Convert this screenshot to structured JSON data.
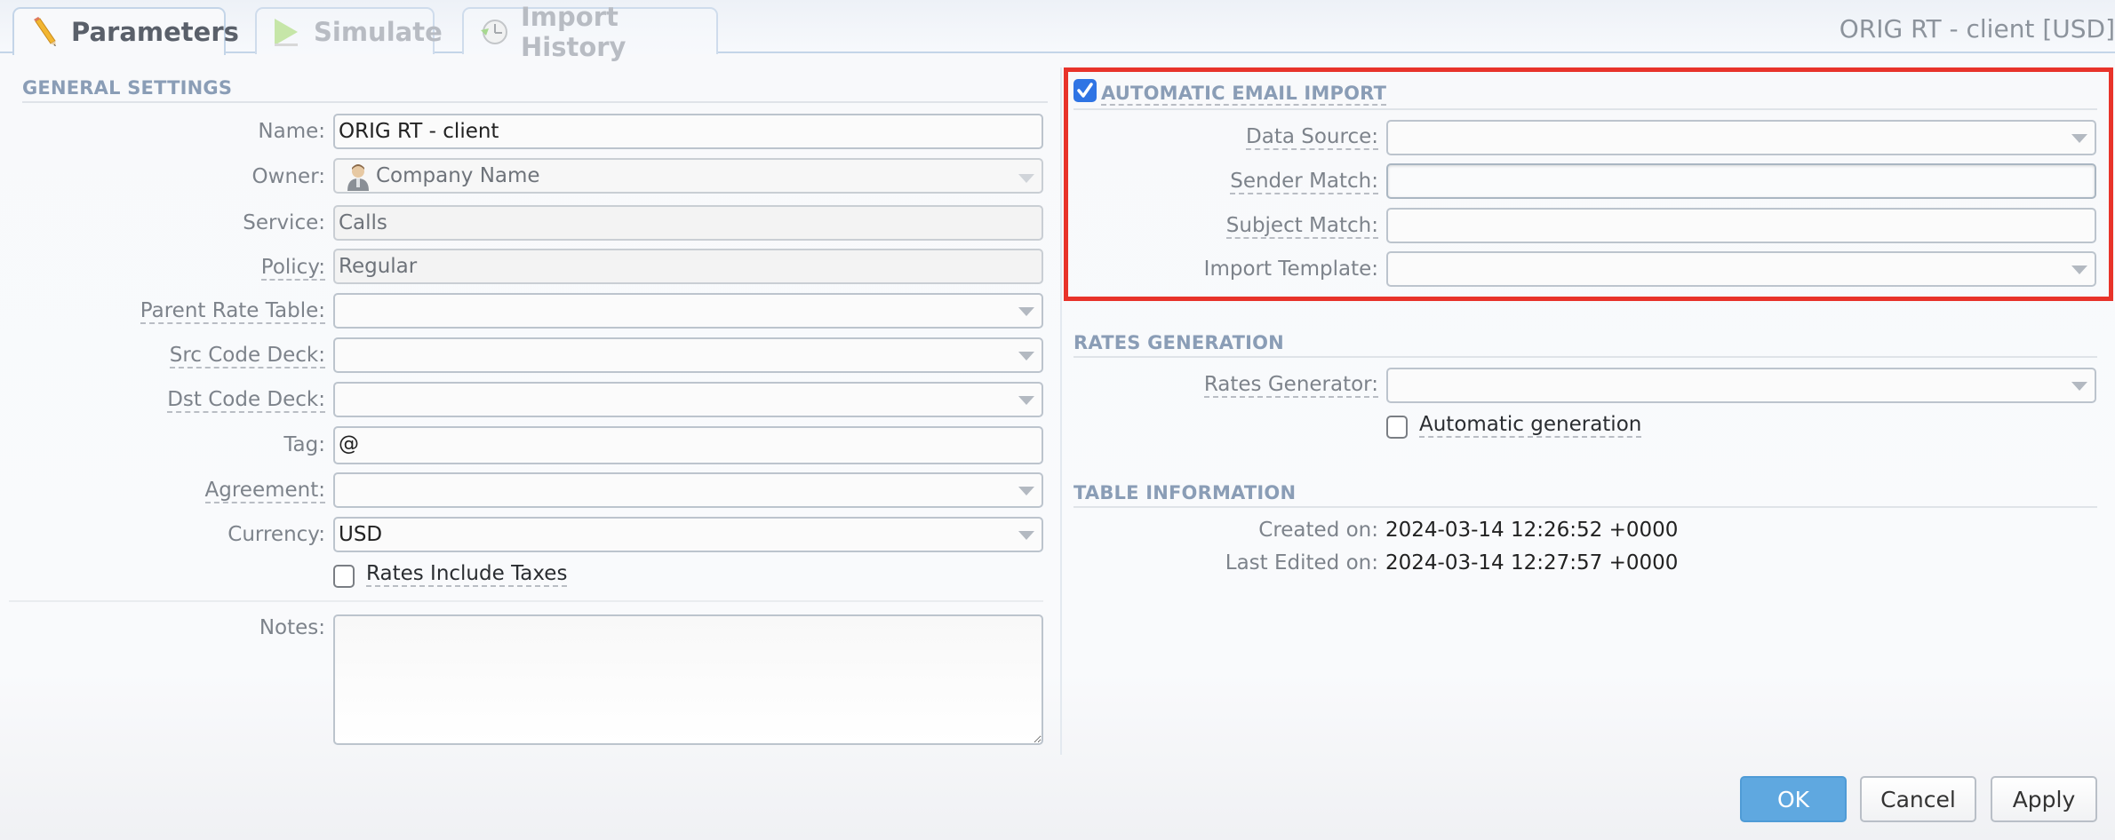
{
  "tabs": [
    {
      "label": "Parameters",
      "icon": "pencil-icon",
      "active": true
    },
    {
      "label": "Simulate",
      "icon": "play-icon",
      "active": false
    },
    {
      "label": "Import History",
      "icon": "clock-history-icon",
      "active": false
    }
  ],
  "window_title": "ORIG RT - client [USD]",
  "general_settings": {
    "header": "GENERAL SETTINGS",
    "fields": {
      "name": {
        "label": "Name:",
        "value": "ORIG RT - client"
      },
      "owner": {
        "label": "Owner:",
        "value": "Company Name",
        "icon": "user-icon"
      },
      "service": {
        "label": "Service:",
        "value": "Calls"
      },
      "policy": {
        "label": "Policy:",
        "value": "Regular"
      },
      "parent_rate_table": {
        "label": "Parent Rate Table:",
        "value": ""
      },
      "src_code_deck": {
        "label": "Src Code Deck:",
        "value": ""
      },
      "dst_code_deck": {
        "label": "Dst Code Deck:",
        "value": ""
      },
      "tag": {
        "label": "Tag:",
        "value": "@"
      },
      "agreement": {
        "label": "Agreement:",
        "value": ""
      },
      "currency": {
        "label": "Currency:",
        "value": "USD"
      },
      "rates_include_taxes": {
        "label": "Rates Include Taxes",
        "checked": false
      },
      "notes": {
        "label": "Notes:",
        "value": ""
      }
    }
  },
  "automatic_email_import": {
    "header": "AUTOMATIC EMAIL IMPORT",
    "enabled": true,
    "highlight_color": "#e8332a",
    "fields": {
      "data_source": {
        "label": "Data Source:",
        "value": ""
      },
      "sender_match": {
        "label": "Sender Match:",
        "value": ""
      },
      "subject_match": {
        "label": "Subject Match:",
        "value": ""
      },
      "import_template": {
        "label": "Import Template:",
        "value": ""
      }
    }
  },
  "rates_generation": {
    "header": "RATES GENERATION",
    "rates_generator": {
      "label": "Rates Generator:",
      "value": ""
    },
    "automatic_generation": {
      "label": "Automatic generation",
      "checked": false
    }
  },
  "table_information": {
    "header": "TABLE INFORMATION",
    "created_on": {
      "label": "Created on:",
      "value": "2024-03-14 12:26:52 +0000"
    },
    "last_edited_on": {
      "label": "Last Edited on:",
      "value": "2024-03-14 12:27:57 +0000"
    }
  },
  "buttons": {
    "ok": "OK",
    "cancel": "Cancel",
    "apply": "Apply"
  },
  "colors": {
    "primary_button": "#5fa8e0",
    "section_header": "#8a9db6",
    "checkbox_checked": "#2f74e4"
  }
}
